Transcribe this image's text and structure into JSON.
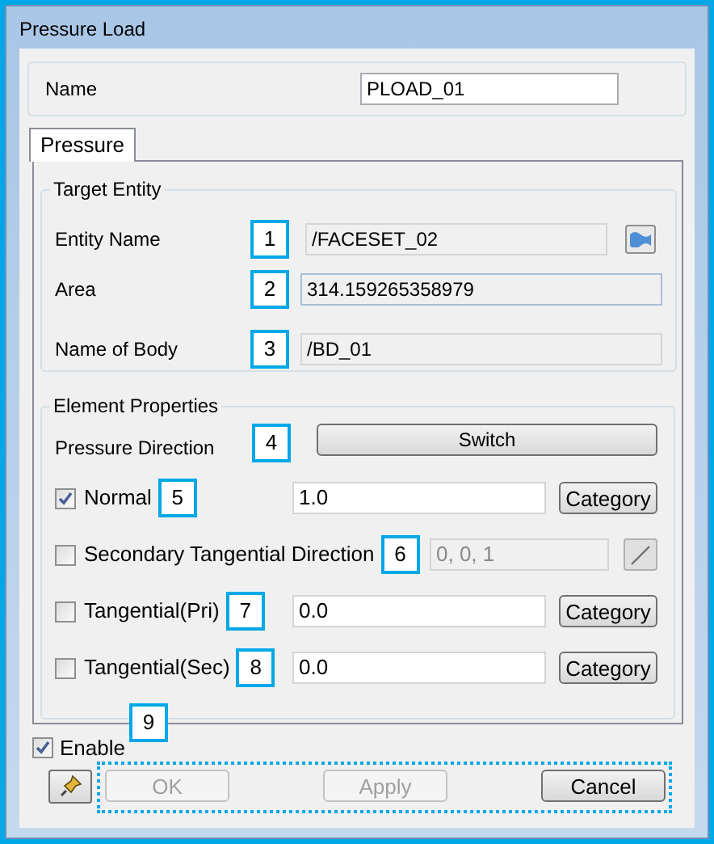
{
  "window": {
    "title": "Pressure Load"
  },
  "name_field": {
    "label": "Name",
    "value": "PLOAD_01"
  },
  "tabs": [
    {
      "label": "Pressure",
      "selected": true
    }
  ],
  "target_entity": {
    "title": "Target Entity",
    "rows": [
      {
        "label": "Entity Name",
        "callout": "1",
        "value": "/FACESET_02",
        "kind": "picker"
      },
      {
        "label": "Area",
        "callout": "2",
        "value": "314.159265358979",
        "kind": "plain"
      },
      {
        "label": "Name of Body",
        "callout": "3",
        "value": "/BD_01",
        "kind": "plain"
      }
    ]
  },
  "element_properties": {
    "title": "Element Properties",
    "direction": {
      "label": "Pressure Direction",
      "callout": "4",
      "button": "Switch"
    },
    "rows": [
      {
        "label": "Normal",
        "checked": true,
        "callout": "5",
        "value": "1.0",
        "kind": "category",
        "button": "Category"
      },
      {
        "label": "Secondary Tangential Direction",
        "checked": false,
        "callout": "6",
        "value": "0, 0, 1",
        "kind": "vector",
        "disabled": true
      },
      {
        "label": "Tangential(Pri)",
        "checked": false,
        "callout": "7",
        "value": "0.0",
        "kind": "category",
        "button": "Category"
      },
      {
        "label": "Tangential(Sec)",
        "checked": false,
        "callout": "8",
        "value": "0.0",
        "kind": "category",
        "button": "Category"
      }
    ]
  },
  "group_callout": "9",
  "enable": {
    "label": "Enable",
    "checked": true
  },
  "buttons": [
    {
      "label": "OK",
      "disabled": true
    },
    {
      "label": "Apply",
      "disabled": true
    },
    {
      "label": "Cancel",
      "disabled": false
    }
  ]
}
